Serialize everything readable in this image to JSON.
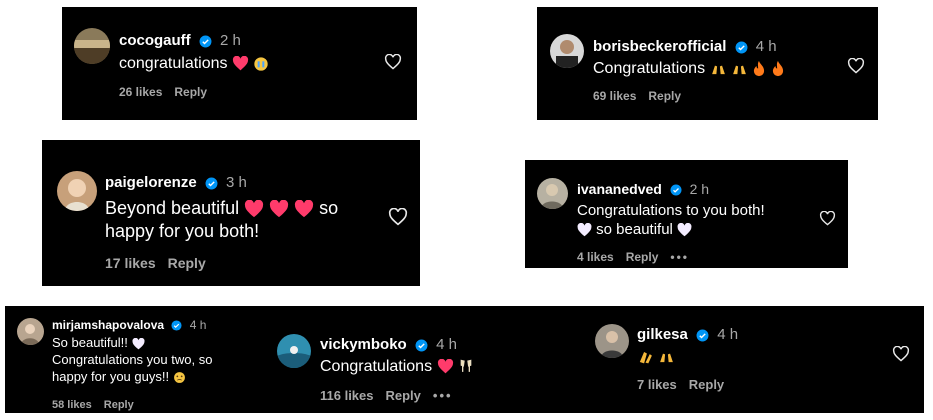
{
  "comments": [
    {
      "user": "cocogauff",
      "time": "2 h",
      "line1": "congratulations",
      "line2": "",
      "likes": "26 likes",
      "reply": "Reply",
      "more": ""
    },
    {
      "user": "borisbeckerofficial",
      "time": "4 h",
      "line1": "Congratulations",
      "line2": "",
      "likes": "69 likes",
      "reply": "Reply",
      "more": ""
    },
    {
      "user": "paigelorenze",
      "time": "3 h",
      "line1": "Beyond beautiful",
      "line1b": "so",
      "line2": "happy for you both!",
      "likes": "17 likes",
      "reply": "Reply",
      "more": ""
    },
    {
      "user": "ivananedved",
      "time": "2 h",
      "line1": "Congratulations to you both!",
      "line2": "so beautiful",
      "likes": "4 likes",
      "reply": "Reply",
      "more": "•••"
    },
    {
      "user": "mirjamshapovalova",
      "time": "4 h",
      "line1": "So beautiful!!",
      "line2": "Congratulations you two, so",
      "line3": "happy for you guys!!",
      "likes": "58 likes",
      "reply": "Reply",
      "more": ""
    },
    {
      "user": "vickymboko",
      "time": "4 h",
      "line1": "Congratulations",
      "line2": "",
      "likes": "116 likes",
      "reply": "Reply",
      "more": "•••"
    },
    {
      "user": "gilkesa",
      "time": "4 h",
      "line1": "",
      "line2": "",
      "likes": "7 likes",
      "reply": "Reply",
      "more": ""
    }
  ],
  "colors": {
    "background": "#000000",
    "text": "#ffffff",
    "muted": "#a8a8a8",
    "verified": "#0095f6",
    "heart": "#ff3b6b"
  },
  "icons": [
    "verified-badge-icon",
    "heart-outline-icon",
    "heart-emoji-icon",
    "white-heart-emoji-icon",
    "raised-hands-emoji-icon",
    "fire-emoji-icon",
    "clapping-hands-emoji-icon",
    "champagne-emoji-icon",
    "crying-face-emoji-icon",
    "more-options-icon"
  ]
}
